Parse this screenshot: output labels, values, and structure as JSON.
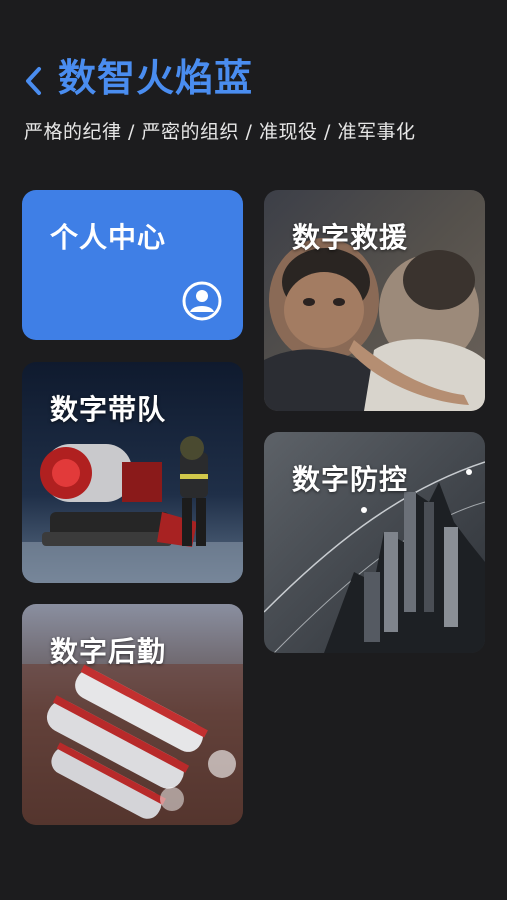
{
  "header": {
    "title": "数智火焰蓝",
    "subtitle": "严格的纪律 / 严密的组织 / 准现役 / 准军事化",
    "back_icon": "chevron-left-icon"
  },
  "cards": {
    "personal": {
      "label": "个人中心",
      "icon": "user-circle-icon",
      "color": "#3f7fe6"
    },
    "rescue": {
      "label": "数字救援"
    },
    "command": {
      "label": "数字带队"
    },
    "prevention": {
      "label": "数字防控"
    },
    "logistics": {
      "label": "数字后勤"
    }
  },
  "colors": {
    "background": "#1c1c1e",
    "accent": "#4a8df0"
  }
}
